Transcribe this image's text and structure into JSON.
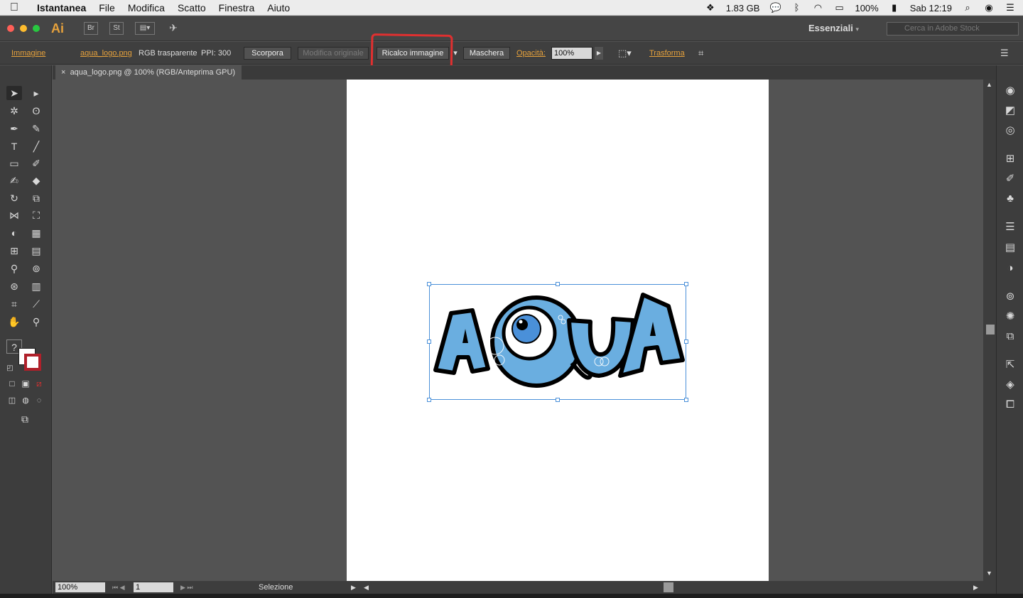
{
  "menubar": {
    "app": "Istantanea",
    "items": [
      "File",
      "Modifica",
      "Scatto",
      "Finestra",
      "Aiuto"
    ],
    "memory": "1.83 GB",
    "battery": "100%",
    "clock": "Sab 12:19"
  },
  "appbar": {
    "logo": "Ai",
    "br_label": "Br",
    "st_label": "St",
    "workspace": "Essenziali",
    "stock_placeholder": "Cerca in Adobe Stock"
  },
  "control": {
    "type": "Immagine",
    "file": "aqua_logo.png",
    "color_mode": "RGB trasparente",
    "ppi": "PPI: 300",
    "btn_scorpora": "Scorpora",
    "btn_modifica": "Modifica originale",
    "btn_ricalco": "Ricalco immagine",
    "btn_maschera": "Maschera",
    "opacity_label": "Opacità:",
    "opacity_value": "100%",
    "trasforma": "Trasforma"
  },
  "tab": {
    "title": "aqua_logo.png @ 100% (RGB/Anteprima GPU)",
    "close": "×"
  },
  "status": {
    "zoom": "100%",
    "page": "1",
    "label": "Selezione"
  },
  "logo_text": "AQUA",
  "colors": {
    "accent": "#e7a23c",
    "selection": "#4a90d9",
    "logo_blue": "#6aaee0"
  }
}
